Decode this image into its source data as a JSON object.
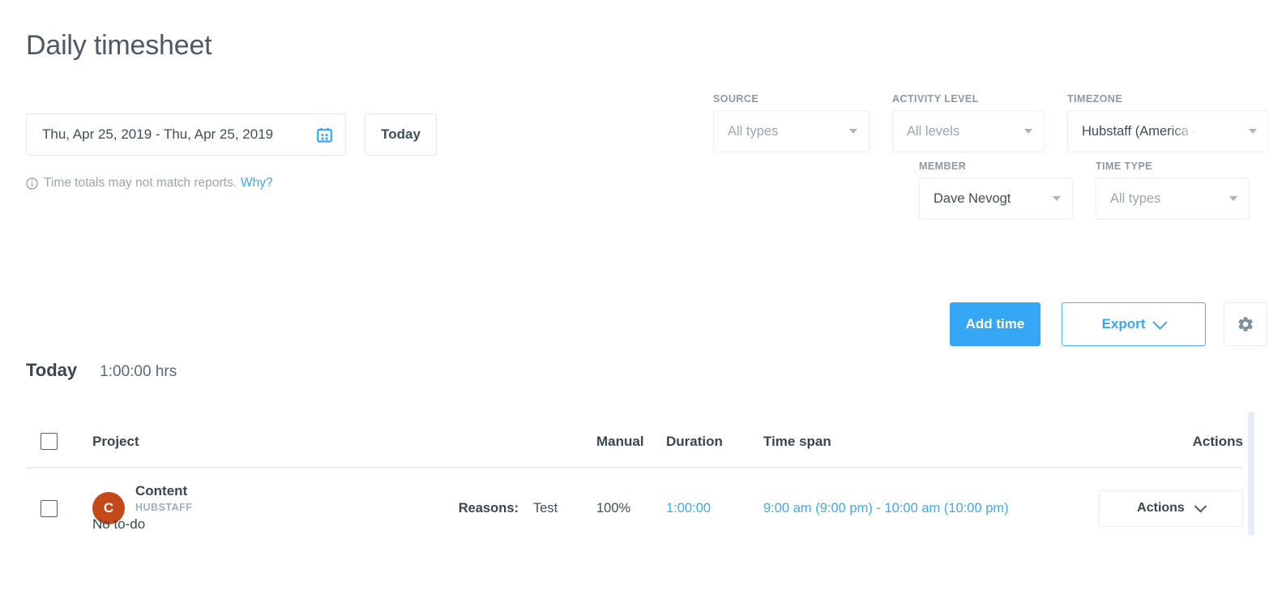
{
  "page": {
    "title": "Daily timesheet"
  },
  "daterange": {
    "value": "Thu, Apr 25, 2019 - Thu, Apr 25, 2019",
    "icon": "calendar-icon",
    "today_label": "Today"
  },
  "notice": {
    "icon": "info-circle-icon",
    "text": "Time totals may not match reports.",
    "link_label": "Why?"
  },
  "filters": {
    "source": {
      "label": "SOURCE",
      "value": "All types",
      "filled": false
    },
    "activity_level": {
      "label": "ACTIVITY LEVEL",
      "value": "All levels",
      "filled": false
    },
    "timezone": {
      "label": "TIMEZONE",
      "value": "Hubstaff (America -",
      "filled": true
    },
    "member": {
      "label": "MEMBER",
      "value": "Dave Nevogt",
      "filled": true
    },
    "time_type": {
      "label": "TIME TYPE",
      "value": "All types",
      "filled": false
    }
  },
  "toolbar": {
    "add_time_label": "Add time",
    "export_label": "Export",
    "settings_icon": "gear-icon"
  },
  "summary": {
    "day_label": "Today",
    "total": "1:00:00 hrs"
  },
  "table": {
    "headers": {
      "project": "Project",
      "manual": "Manual",
      "duration": "Duration",
      "time_span": "Time span",
      "actions": "Actions"
    },
    "rows": [
      {
        "avatar_initial": "C",
        "avatar_color": "#c4491a",
        "project": "Content",
        "organization": "HUBSTAFF",
        "todo": "No to-do",
        "reasons_label": "Reasons:",
        "reason": "Test",
        "manual": "100%",
        "duration": "1:00:00",
        "time_span": "9:00 am (9:00 pm) - 10:00 am (10:00 pm)",
        "actions_label": "Actions"
      }
    ]
  },
  "colors": {
    "accent_blue": "#36a7f5",
    "link_blue": "#3bacf0",
    "text_dark": "#39474f",
    "muted": "#9aa7b0",
    "border": "#e9eef3"
  }
}
